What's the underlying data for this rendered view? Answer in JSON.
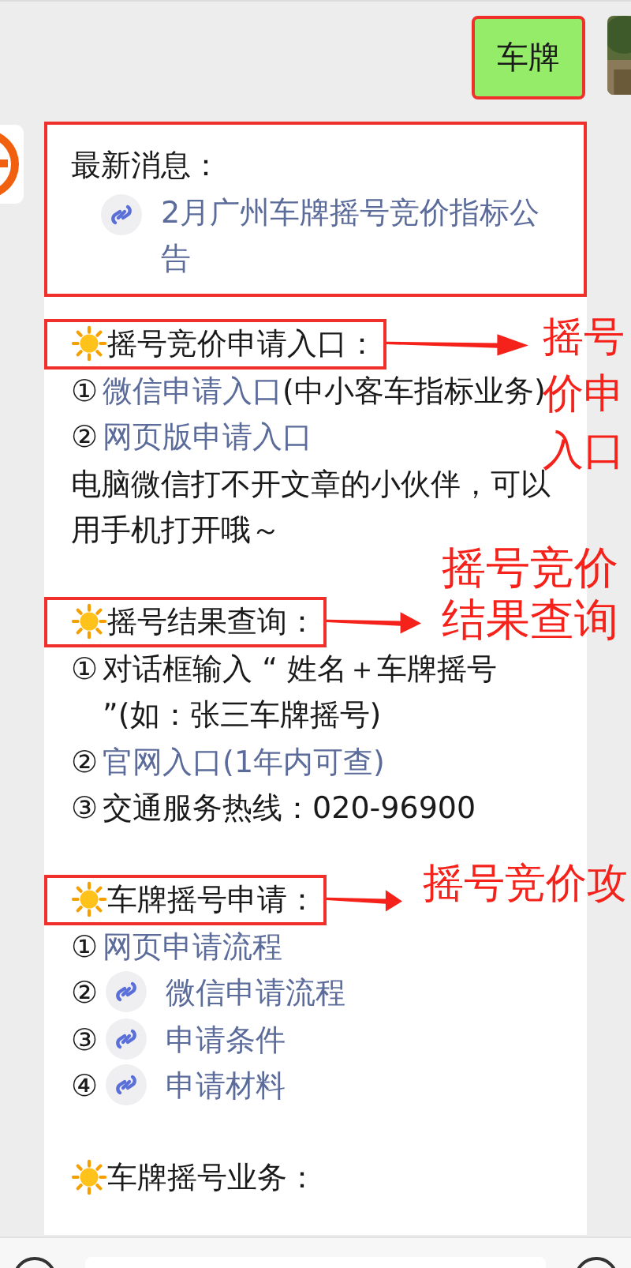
{
  "outgoing_message": {
    "text": "车牌",
    "highlighted": true
  },
  "article": {
    "latest": {
      "label": "最新消息：",
      "link": "2月广州车牌摇号竞价指标公告",
      "highlighted": true
    },
    "sections": [
      {
        "title": "摇号竞价申请入口：",
        "highlighted": true,
        "note": {
          "lines": [
            "摇号",
            "价申",
            "入口"
          ]
        },
        "items": [
          {
            "kind": "link",
            "num": "①",
            "text": "微信申请入口",
            "suffix": "(中小客车指标业务)"
          },
          {
            "kind": "link",
            "num": "②",
            "text": "网页版申请入口"
          },
          {
            "kind": "text",
            "text": "电脑微信打不开文章的小伙伴，可以用手机打开哦～"
          }
        ]
      },
      {
        "title": "摇号结果查询：",
        "highlighted": true,
        "note": {
          "lines": [
            "摇号竞价",
            "结果查询"
          ]
        },
        "items": [
          {
            "kind": "text",
            "num": "①",
            "text": "对话框输入 “ 姓名＋车牌摇号 ”(如：张三车牌摇号)"
          },
          {
            "kind": "link",
            "num": "②",
            "text": "官网入口(1年内可查)"
          },
          {
            "kind": "text",
            "num": "③",
            "text": "交通服务热线：020-96900"
          }
        ]
      },
      {
        "title": "车牌摇号申请：",
        "highlighted": true,
        "note": {
          "lines": [
            "摇号竞价攻"
          ]
        },
        "items": [
          {
            "kind": "link",
            "num": "①",
            "text": "网页申请流程"
          },
          {
            "kind": "miniapp",
            "num": "②",
            "text": "微信申请流程"
          },
          {
            "kind": "miniapp",
            "num": "③",
            "text": "申请条件"
          },
          {
            "kind": "miniapp",
            "num": "④",
            "text": "申请材料"
          }
        ]
      },
      {
        "title": "车牌摇号业务：",
        "highlighted": false
      }
    ]
  }
}
